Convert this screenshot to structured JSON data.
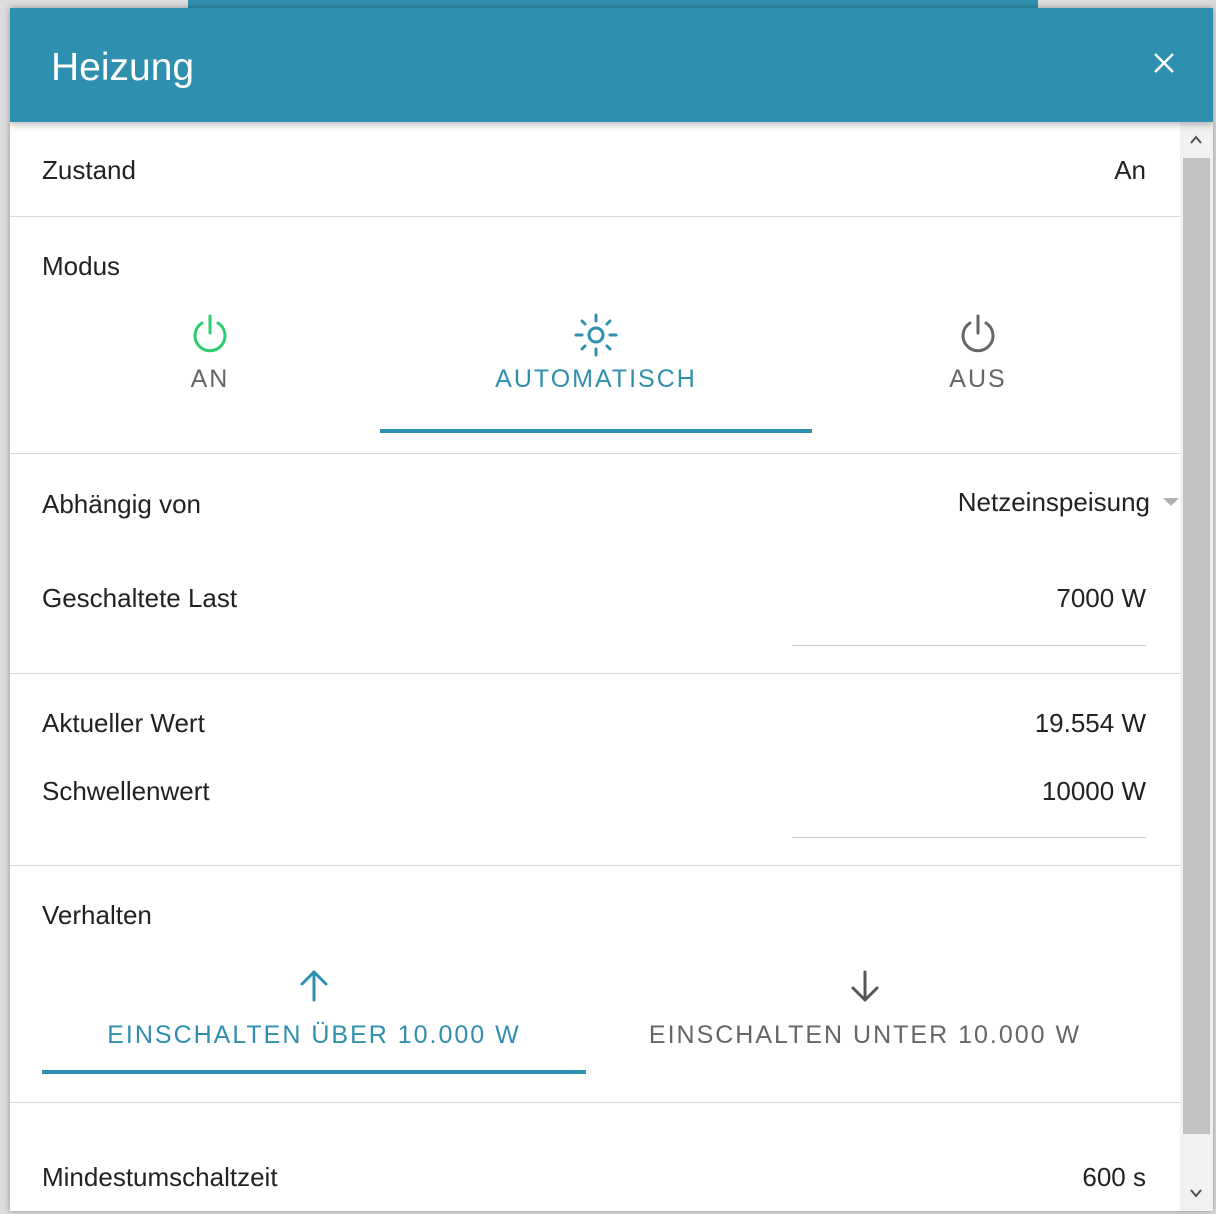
{
  "dialog": {
    "title": "Heizung",
    "close_icon": "close-icon"
  },
  "state": {
    "label": "Zustand",
    "value": "An"
  },
  "mode": {
    "label": "Modus",
    "selected": "AUTOMATISCH",
    "tabs": [
      {
        "label": "AN",
        "icon": "power-icon",
        "color": "#2ecc71"
      },
      {
        "label": "AUTOMATISCH",
        "icon": "sun-icon",
        "color": "#2f8fae"
      },
      {
        "label": "AUS",
        "icon": "power-icon",
        "color": "#666666"
      }
    ]
  },
  "dependency": {
    "label": "Abhängig von",
    "value": "Netzeinspeisung"
  },
  "switched_load": {
    "label": "Geschaltete Last",
    "value": "7000 W"
  },
  "current_value": {
    "label": "Aktueller Wert",
    "value": "19.554 W"
  },
  "threshold": {
    "label": "Schwellenwert",
    "value": "10000 W"
  },
  "behavior": {
    "label": "Verhalten",
    "selected": "EINSCHALTEN ÜBER 10.000 W",
    "tabs": [
      {
        "label": "EINSCHALTEN ÜBER 10.000 W",
        "icon": "arrow-up-icon",
        "color": "#2f8fae"
      },
      {
        "label": "EINSCHALTEN UNTER 10.000 W",
        "icon": "arrow-down-icon",
        "color": "#666666"
      }
    ]
  },
  "min_switch_time": {
    "label": "Mindestumschaltzeit",
    "value": "600 s"
  },
  "colors": {
    "accent": "#2f8fae",
    "on_green": "#2ecc71",
    "inactive": "#666666"
  }
}
